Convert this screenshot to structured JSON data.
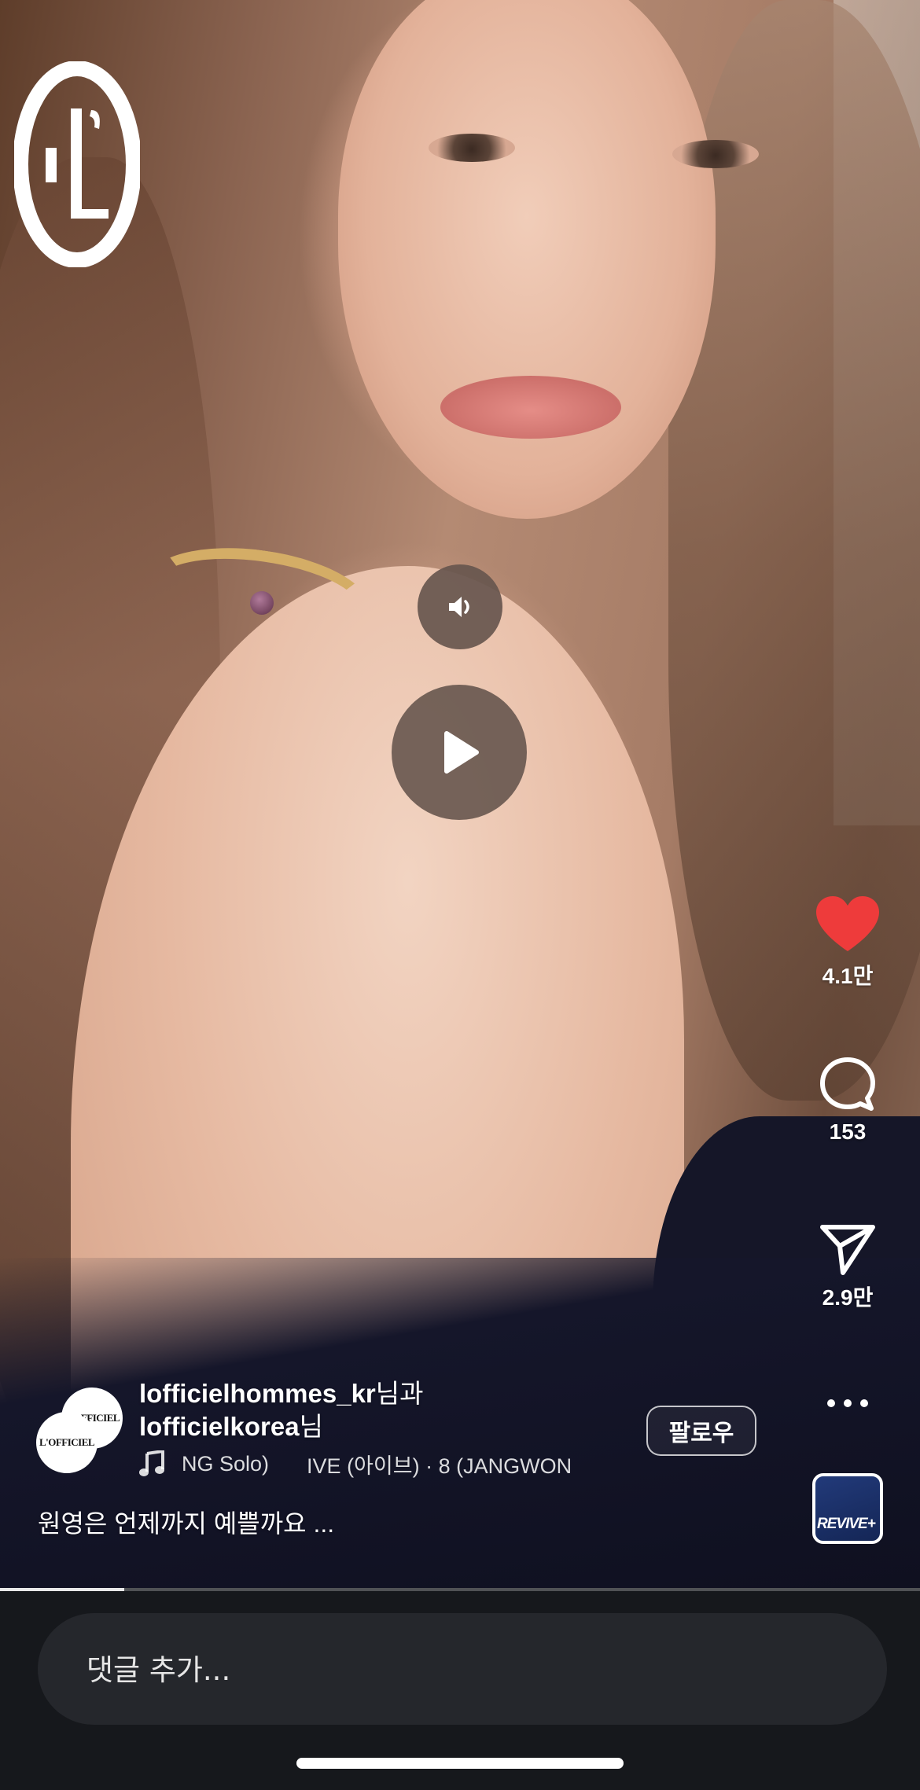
{
  "post": {
    "brand_logo": "L'Officiel Korea logo",
    "owners": [
      {
        "username": "lofficielhommes_kr",
        "suffix": "님과"
      },
      {
        "username": "lofficielkorea",
        "suffix": "님"
      }
    ],
    "follow_label": "팔로우",
    "music": {
      "icon": "music-note-icon",
      "text_left": "NG Solo)",
      "text_right": "IVE (아이브) · 8 (JANGWON"
    },
    "caption": "원영은 언제까지 예쁠까요 ..."
  },
  "actions": {
    "like": {
      "icon": "heart-icon",
      "count": "4.1만",
      "color": "#ee3b3b"
    },
    "comment": {
      "icon": "comment-icon",
      "count": "153"
    },
    "share": {
      "icon": "send-icon",
      "count": "2.9만"
    },
    "more": {
      "icon": "more-icon"
    },
    "audio": {
      "icon": "audio-thumbnail",
      "label": "REVIVE+"
    }
  },
  "player": {
    "sound_icon": "speaker-icon",
    "play_icon": "play-icon",
    "progress": 0.135
  },
  "comment_box": {
    "placeholder": "댓글 추가..."
  },
  "avatars": {
    "back_text": "L'OFFICIEL",
    "front_text": "L'OFFICIEL"
  }
}
